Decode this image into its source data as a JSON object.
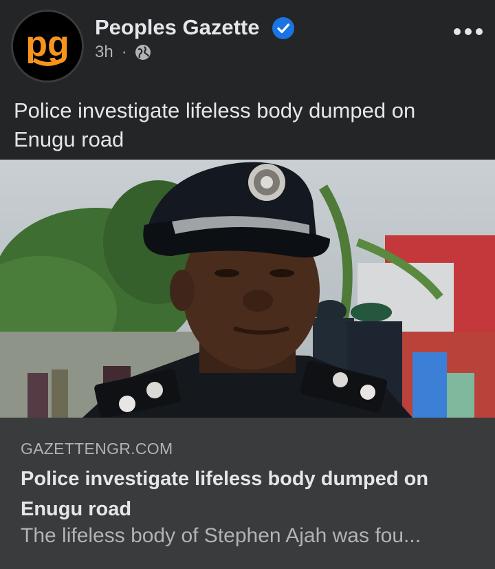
{
  "header": {
    "page_name": "Peoples Gazette",
    "time": "3h",
    "separator": "·",
    "logo_text": "pg",
    "avatar_icon": "peoples-gazette-logo",
    "verified_icon": "verified-badge-icon",
    "audience_icon": "globe-icon",
    "more_icon": "more-options-icon"
  },
  "post": {
    "text": "Police investigate lifeless body dumped on Enugu road"
  },
  "link_preview": {
    "domain": "GAZETTENGR.COM",
    "title": "Police investigate lifeless body dumped on Enugu road",
    "description": "The lifeless body of Stephen Ajah was fou..."
  },
  "colors": {
    "background": "#242526",
    "card": "#3a3b3c",
    "verified": "#1b74e4",
    "logo_orange": "#f7941d"
  }
}
